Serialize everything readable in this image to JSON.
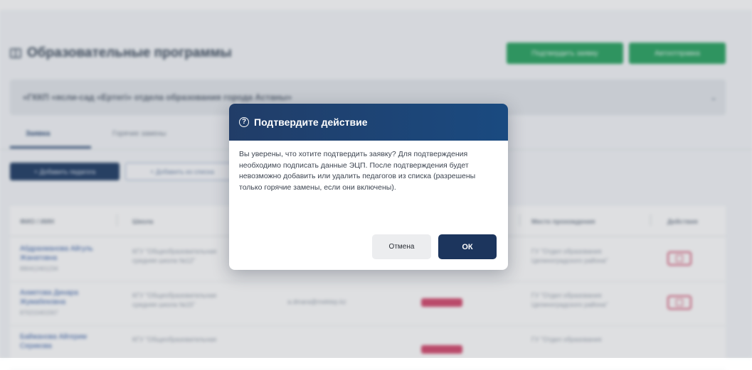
{
  "page": {
    "title": "Образовательные программы",
    "actions": [
      "Подтвердить заявку",
      "Автоотправка"
    ]
  },
  "organization": {
    "name": "«ГККП «ясли-сад «Ертегі» отдела образования города Астаны»"
  },
  "tabs": [
    "Заявка",
    "Горячие замены"
  ],
  "toolbar": {
    "add_label": "+ Добавить педагога",
    "import_label": "+ Добавить из списка"
  },
  "table": {
    "columns": [
      "ФИО / ИИН",
      "Школа",
      "",
      "",
      "Место прохождения",
      "Действия"
    ],
    "rows": [
      {
        "name": "Абдрахманова Айгуль Жанатовна",
        "iin": "890412401234",
        "school": "КГУ \"Общеобразовательная средняя школа №12\"",
        "email": "",
        "dept": "ГУ \"Отдел образования Целиноградского района\""
      },
      {
        "name": "Ахметова Динара Жумабековна",
        "iin": "870215401567",
        "school": "КГУ \"Общеобразовательная средняя школа №15\"",
        "email": "a.dinara@mektep.kz",
        "dept": "ГУ \"Отдел образования Целиноградского района\""
      },
      {
        "name": "Байжанова Айгерим Серикова",
        "iin": "",
        "school": "КГУ \"Общеобразовательная",
        "email": "",
        "dept": "ГУ \"Отдел образования"
      }
    ]
  },
  "modal": {
    "title": "Подтвердите действие",
    "icon": "question-circle-icon",
    "message": "Вы уверены, что хотите подтвердить заявку? Для подтверждения необходимо подписать данные ЭЦП. После подтверждения будет невозможно добавить или удалить педагогов из списка (разрешены только горячие замены, если они включены).",
    "cancel_label": "Отмена",
    "ok_label": "ОК"
  },
  "colors": {
    "header_dark": "#1c355d",
    "accent_green": "#2aa462",
    "danger": "#d25070"
  }
}
